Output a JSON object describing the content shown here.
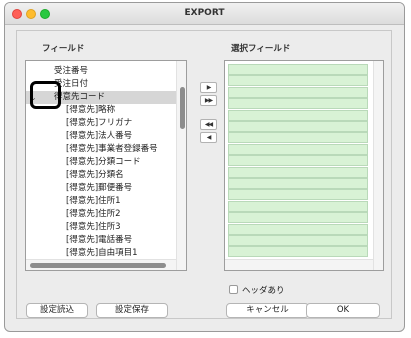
{
  "window": {
    "title": "EXPORT"
  },
  "field_list": {
    "label": "フィールド",
    "items": [
      {
        "label": "受注番号",
        "level": 0,
        "selected": false,
        "chevron": false
      },
      {
        "label": "受注日付",
        "level": 0,
        "selected": false,
        "chevron": false
      },
      {
        "label": "得意先コード",
        "level": 0,
        "selected": true,
        "chevron": true
      },
      {
        "label": "[得意先]略称",
        "level": 1,
        "selected": false,
        "chevron": false
      },
      {
        "label": "[得意先]フリガナ",
        "level": 1,
        "selected": false,
        "chevron": false
      },
      {
        "label": "[得意先]法人番号",
        "level": 1,
        "selected": false,
        "chevron": false
      },
      {
        "label": "[得意先]事業者登録番号",
        "level": 1,
        "selected": false,
        "chevron": false
      },
      {
        "label": "[得意先]分類コード",
        "level": 1,
        "selected": false,
        "chevron": false
      },
      {
        "label": "[得意先]分類名",
        "level": 1,
        "selected": false,
        "chevron": false
      },
      {
        "label": "[得意先]郵便番号",
        "level": 1,
        "selected": false,
        "chevron": false
      },
      {
        "label": "[得意先]住所1",
        "level": 1,
        "selected": false,
        "chevron": false
      },
      {
        "label": "[得意先]住所2",
        "level": 1,
        "selected": false,
        "chevron": false
      },
      {
        "label": "[得意先]住所3",
        "level": 1,
        "selected": false,
        "chevron": false
      },
      {
        "label": "[得意先]電話番号",
        "level": 1,
        "selected": false,
        "chevron": false
      },
      {
        "label": "[得意先]自由項目1",
        "level": 1,
        "selected": false,
        "chevron": false
      }
    ]
  },
  "selected_list": {
    "label": "選択フィールド",
    "row_count": 17
  },
  "move_buttons": {
    "add": "▶",
    "add_all": "▶▶",
    "remove_all": "◀◀",
    "remove": "◀"
  },
  "header_checkbox": {
    "label": "ヘッダあり",
    "checked": false
  },
  "buttons": {
    "load_settings": "設定読込",
    "save_settings": "設定保存",
    "cancel": "キャンセル",
    "ok": "OK"
  },
  "colors": {
    "selected_row": "#d6d6d6",
    "selected_field_row": "#d8f2d5",
    "close": "#fe5f57",
    "minimize": "#febc2e",
    "maximize": "#28c840"
  }
}
